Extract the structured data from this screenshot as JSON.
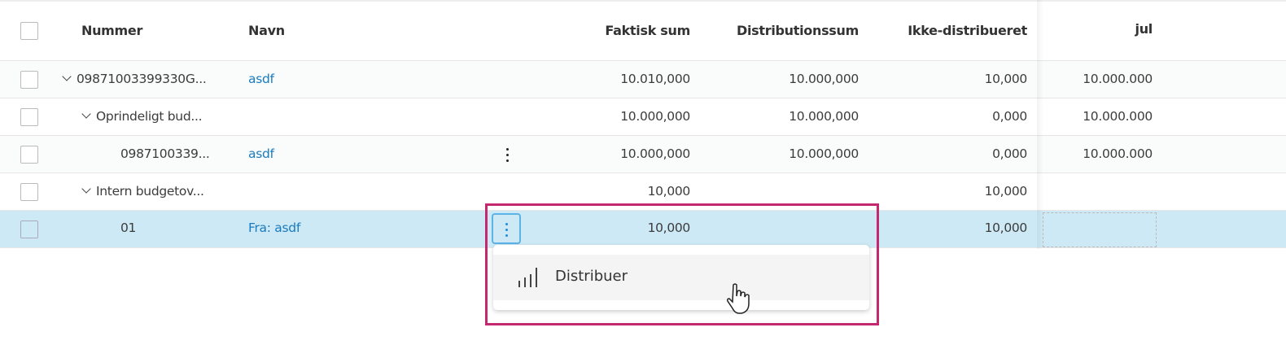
{
  "headers": {
    "number": "Nummer",
    "name": "Navn",
    "actual_sum": "Faktisk sum",
    "distribution_sum": "Distributionssum",
    "undistributed": "Ikke-distribueret",
    "jul": "jul"
  },
  "rows": [
    {
      "number": "09871003399330G...",
      "name": "asdf",
      "actual_sum": "10.010,000",
      "distribution_sum": "10.000,000",
      "undistributed": "10,000",
      "jul": "10.000.000"
    },
    {
      "number": "Oprindeligt bud...",
      "name": "",
      "actual_sum": "10.000,000",
      "distribution_sum": "10.000,000",
      "undistributed": "0,000",
      "jul": "10.000.000"
    },
    {
      "number": "0987100339...",
      "name": "asdf",
      "actual_sum": "10.000,000",
      "distribution_sum": "10.000,000",
      "undistributed": "0,000",
      "jul": "10.000.000"
    },
    {
      "number": "Intern budgetov...",
      "name": "",
      "actual_sum": "10,000",
      "distribution_sum": "",
      "undistributed": "10,000",
      "jul": ""
    },
    {
      "number": "01",
      "name": "Fra: asdf",
      "actual_sum": "10,000",
      "distribution_sum": "",
      "undistributed": "10,000",
      "jul": ""
    }
  ],
  "context_menu": {
    "items": [
      {
        "label": "Distribuer",
        "icon": "bar-chart-icon"
      }
    ]
  },
  "colors": {
    "link": "#1a7bbf",
    "selected_row": "#cde9f5",
    "highlight": "#c4286e"
  }
}
